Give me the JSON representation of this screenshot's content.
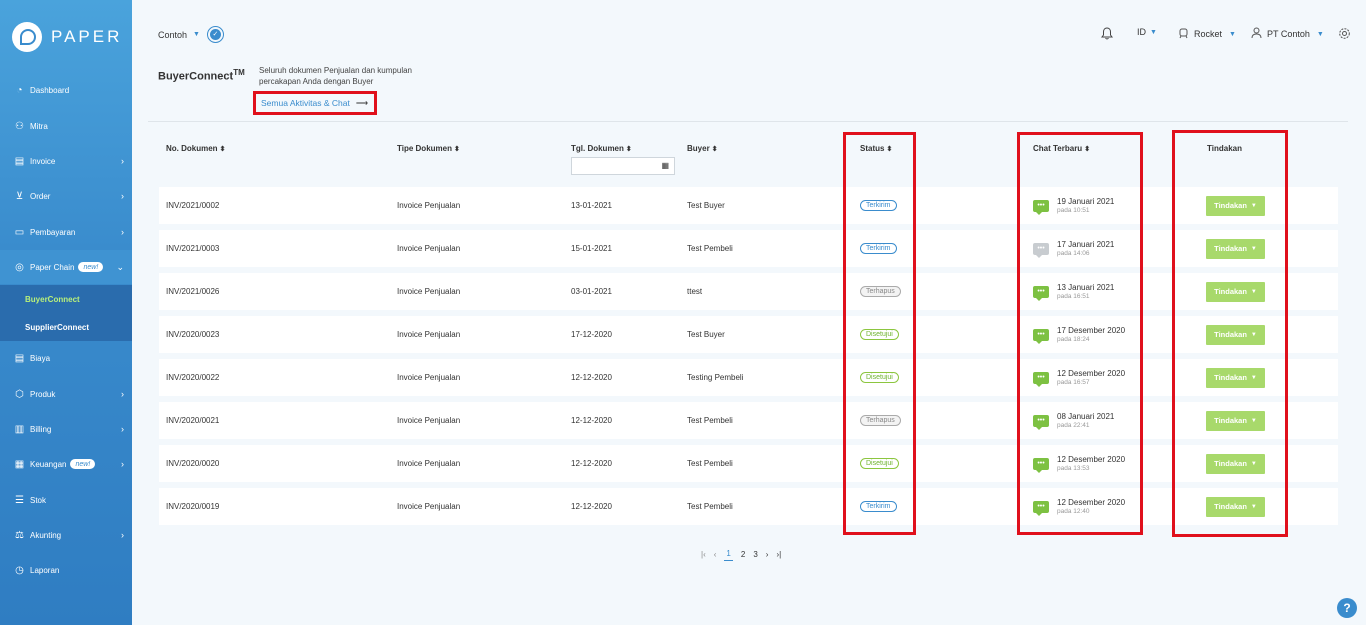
{
  "brand": {
    "name": "PAPER"
  },
  "sidebar": {
    "items": [
      {
        "label": "Dashboard",
        "icon": "dashboard-icon",
        "has_chevron": false
      },
      {
        "label": "Mitra",
        "icon": "partners-icon",
        "has_chevron": false
      },
      {
        "label": "Invoice",
        "icon": "invoice-icon",
        "has_chevron": true
      },
      {
        "label": "Order",
        "icon": "cart-icon",
        "has_chevron": true
      },
      {
        "label": "Pembayaran",
        "icon": "card-icon",
        "has_chevron": true
      },
      {
        "label": "Paper Chain",
        "icon": "chain-icon",
        "has_chevron": true,
        "badge": "new!"
      },
      {
        "label": "Biaya",
        "icon": "receipt-icon",
        "has_chevron": false
      },
      {
        "label": "Produk",
        "icon": "box-icon",
        "has_chevron": true
      },
      {
        "label": "Billing",
        "icon": "billing-icon",
        "has_chevron": true
      },
      {
        "label": "Keuangan",
        "icon": "bank-icon",
        "has_chevron": true,
        "badge": "new!"
      },
      {
        "label": "Stok",
        "icon": "stock-icon",
        "has_chevron": false
      },
      {
        "label": "Akunting",
        "icon": "scale-icon",
        "has_chevron": true
      },
      {
        "label": "Laporan",
        "icon": "report-icon",
        "has_chevron": false
      }
    ],
    "sub_items": [
      "BuyerConnect",
      "SupplierConnect"
    ]
  },
  "topbar": {
    "company": "Contoh",
    "language": "ID",
    "plan": "Rocket",
    "user": "PT Contoh"
  },
  "header": {
    "title": "BuyerConnect",
    "trademark": "TM",
    "description": "Seluruh dokumen Penjualan dan kumpulan percakapan Anda dengan Buyer",
    "link_label": "Semua Aktivitas & Chat"
  },
  "table": {
    "columns": [
      "No. Dokumen",
      "Tipe Dokumen",
      "Tgl. Dokumen",
      "Buyer",
      "Status",
      "Chat Terbaru",
      "Tindakan"
    ],
    "action_label": "Tindakan",
    "rows": [
      {
        "doc_no": "INV/2021/0002",
        "type": "Invoice Penjualan",
        "date": "13-01-2021",
        "buyer": "Test Buyer",
        "status": "Terkirim",
        "status_color": "blue",
        "chat_date": "19 Januari 2021",
        "chat_time": "pada 10:51",
        "chat_color": "green"
      },
      {
        "doc_no": "INV/2021/0003",
        "type": "Invoice Penjualan",
        "date": "15-01-2021",
        "buyer": "Test Pembeli",
        "status": "Terkirim",
        "status_color": "blue",
        "chat_date": "17 Januari 2021",
        "chat_time": "pada 14:06",
        "chat_color": "grey"
      },
      {
        "doc_no": "INV/2021/0026",
        "type": "Invoice Penjualan",
        "date": "03-01-2021",
        "buyer": "ttest",
        "status": "Terhapus",
        "status_color": "grey",
        "chat_date": "13 Januari 2021",
        "chat_time": "pada 16:51",
        "chat_color": "green"
      },
      {
        "doc_no": "INV/2020/0023",
        "type": "Invoice Penjualan",
        "date": "17-12-2020",
        "buyer": "Test Buyer",
        "status": "Disetujui",
        "status_color": "green",
        "chat_date": "17 Desember 2020",
        "chat_time": "pada 18:24",
        "chat_color": "green"
      },
      {
        "doc_no": "INV/2020/0022",
        "type": "Invoice Penjualan",
        "date": "12-12-2020",
        "buyer": "Testing Pembeli",
        "status": "Disetujui",
        "status_color": "green",
        "chat_date": "12 Desember 2020",
        "chat_time": "pada 16:57",
        "chat_color": "green"
      },
      {
        "doc_no": "INV/2020/0021",
        "type": "Invoice Penjualan",
        "date": "12-12-2020",
        "buyer": "Test Pembeli",
        "status": "Terhapus",
        "status_color": "grey",
        "chat_date": "08 Januari 2021",
        "chat_time": "pada 22:41",
        "chat_color": "green"
      },
      {
        "doc_no": "INV/2020/0020",
        "type": "Invoice Penjualan",
        "date": "12-12-2020",
        "buyer": "Test Pembeli",
        "status": "Disetujui",
        "status_color": "green",
        "chat_date": "12 Desember 2020",
        "chat_time": "pada 13:53",
        "chat_color": "green"
      },
      {
        "doc_no": "INV/2020/0019",
        "type": "Invoice Penjualan",
        "date": "12-12-2020",
        "buyer": "Test Pembeli",
        "status": "Terkirim",
        "status_color": "blue",
        "chat_date": "12 Desember 2020",
        "chat_time": "pada 12:40",
        "chat_color": "green"
      }
    ]
  },
  "pagination": {
    "pages": [
      "1",
      "2",
      "3"
    ],
    "current": "1"
  },
  "help": {
    "label": "?"
  }
}
